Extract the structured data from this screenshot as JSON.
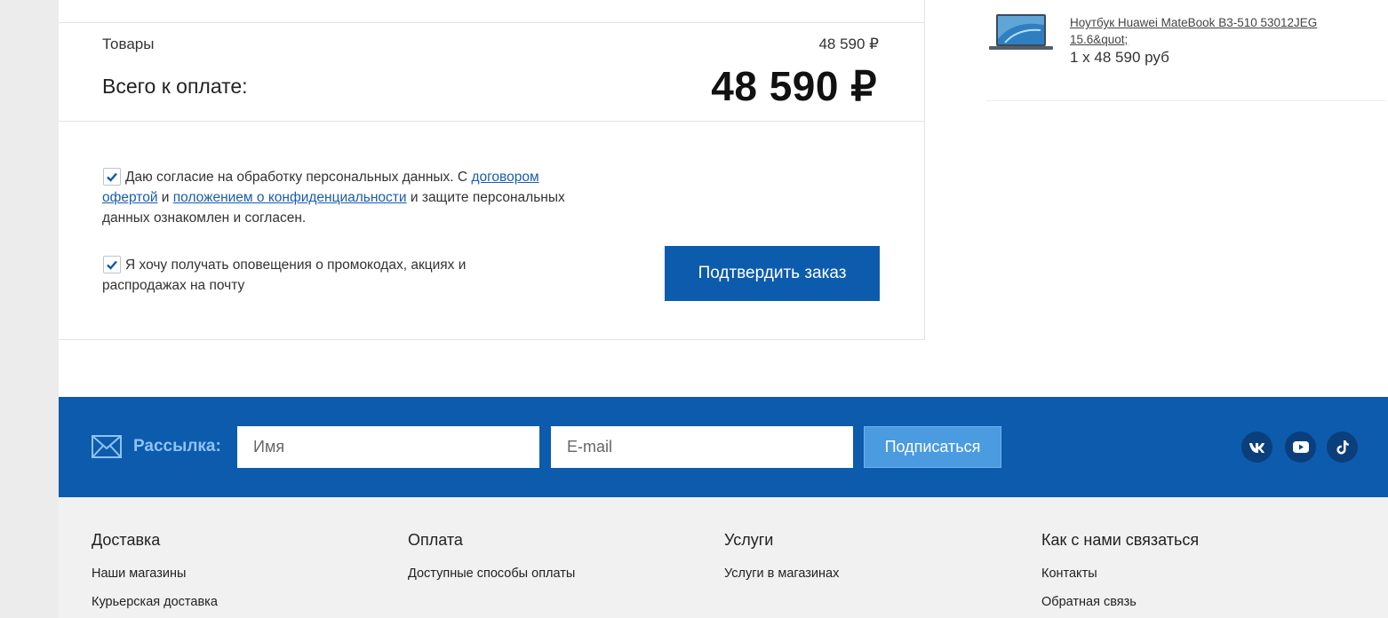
{
  "summary": {
    "goods_label": "Товары",
    "goods_value": "48 590 ₽",
    "total_label": "Всего к оплате:",
    "total_value": "48 590 ₽"
  },
  "consent": {
    "text_1": "Даю согласие на обработку персональных данных. С ",
    "link_offer": "договором офертой",
    "text_2": " и ",
    "link_privacy": "положением о конфиденциальности",
    "text_3": " и защите персональных данных ознакомлен и согласен.",
    "checked": true
  },
  "promo": {
    "text": "Я хочу получать оповещения о промокодах, акциях и распродажах на почту",
    "checked": true
  },
  "confirm_button": "Подтвердить заказ",
  "cart": {
    "item_name": "Ноутбук Huawei MateBook B3-510 53012JEG 15.6&quot;",
    "item_qty": "1 x 48 590 руб"
  },
  "newsletter": {
    "label": "Рассылка:",
    "name_placeholder": "Имя",
    "email_placeholder": "E-mail",
    "subscribe_label": "Подписаться",
    "social": [
      "vk-icon",
      "youtube-icon",
      "tiktok-icon"
    ]
  },
  "footer": {
    "columns": [
      {
        "title": "Доставка",
        "links": [
          "Наши магазины",
          "Курьерская доставка"
        ]
      },
      {
        "title": "Оплата",
        "links": [
          "Доступные способы оплаты"
        ]
      },
      {
        "title": "Услуги",
        "links": [
          "Услуги в магазинах"
        ]
      },
      {
        "title": "Как с нами связаться",
        "links": [
          "Контакты",
          "Обратная связь"
        ]
      }
    ]
  },
  "colors": {
    "brand_blue": "#0d5bad",
    "subscribe_blue": "#4a9be0",
    "footer_bg": "#f1f1f1"
  }
}
